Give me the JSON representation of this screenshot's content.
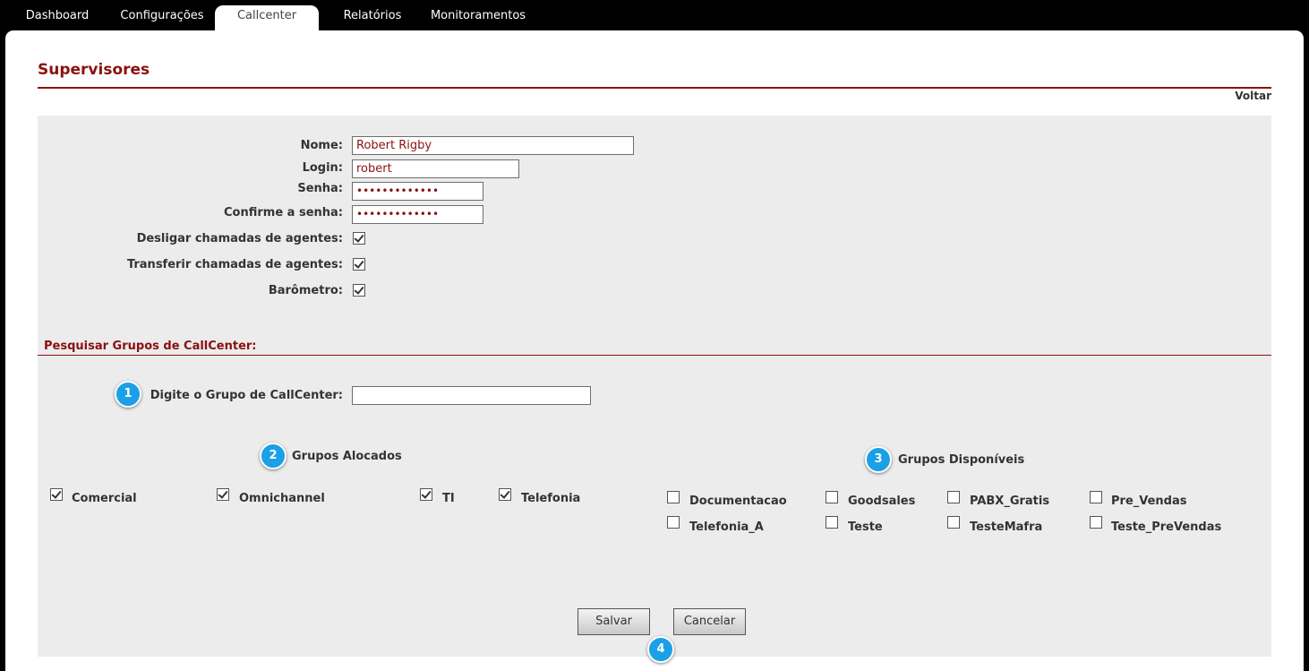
{
  "nav": {
    "tabs": [
      {
        "label": "Dashboard"
      },
      {
        "label": "Configurações"
      },
      {
        "label": "Callcenter"
      },
      {
        "label": "Relatórios"
      },
      {
        "label": "Monitoramentos"
      }
    ],
    "active_tab": "Callcenter"
  },
  "page": {
    "title": "Supervisores",
    "back_link": "Voltar"
  },
  "form": {
    "nome_label": "Nome:",
    "nome_value": "Robert Rigby",
    "login_label": "Login:",
    "login_value": "robert",
    "senha_label": "Senha:",
    "senha_value": "•••••••••••••",
    "confirm_label": "Confirme a senha:",
    "confirm_value": "•••••••••••••",
    "desligar_label": "Desligar chamadas de agentes:",
    "desligar_checked": true,
    "transferir_label": "Transferir chamadas de agentes:",
    "transferir_checked": true,
    "barometro_label": "Barômetro:",
    "barometro_checked": true
  },
  "search": {
    "section_title": "Pesquisar Grupos de CallCenter:",
    "label": "Digite o Grupo de CallCenter:",
    "value": ""
  },
  "groups": {
    "allocated_title": "Grupos Alocados",
    "available_title": "Grupos Disponíveis",
    "allocated": [
      {
        "label": "Comercial",
        "checked": true
      },
      {
        "label": "Omnichannel",
        "checked": true
      },
      {
        "label": "TI",
        "checked": true
      },
      {
        "label": "Telefonia",
        "checked": true
      }
    ],
    "available": [
      {
        "label": "Documentacao",
        "checked": false
      },
      {
        "label": "Goodsales",
        "checked": false
      },
      {
        "label": "PABX_Gratis",
        "checked": false
      },
      {
        "label": "Pre_Vendas",
        "checked": false
      },
      {
        "label": "Telefonia_A",
        "checked": false
      },
      {
        "label": "Teste",
        "checked": false
      },
      {
        "label": "TesteMafra",
        "checked": false
      },
      {
        "label": "Teste_PreVendas",
        "checked": false
      }
    ]
  },
  "buttons": {
    "save": "Salvar",
    "cancel": "Cancelar"
  },
  "badges": [
    "1",
    "2",
    "3",
    "4"
  ],
  "colors": {
    "accent": "#8b1010",
    "badge": "#1aa0e6",
    "form_bg": "#ececec"
  }
}
